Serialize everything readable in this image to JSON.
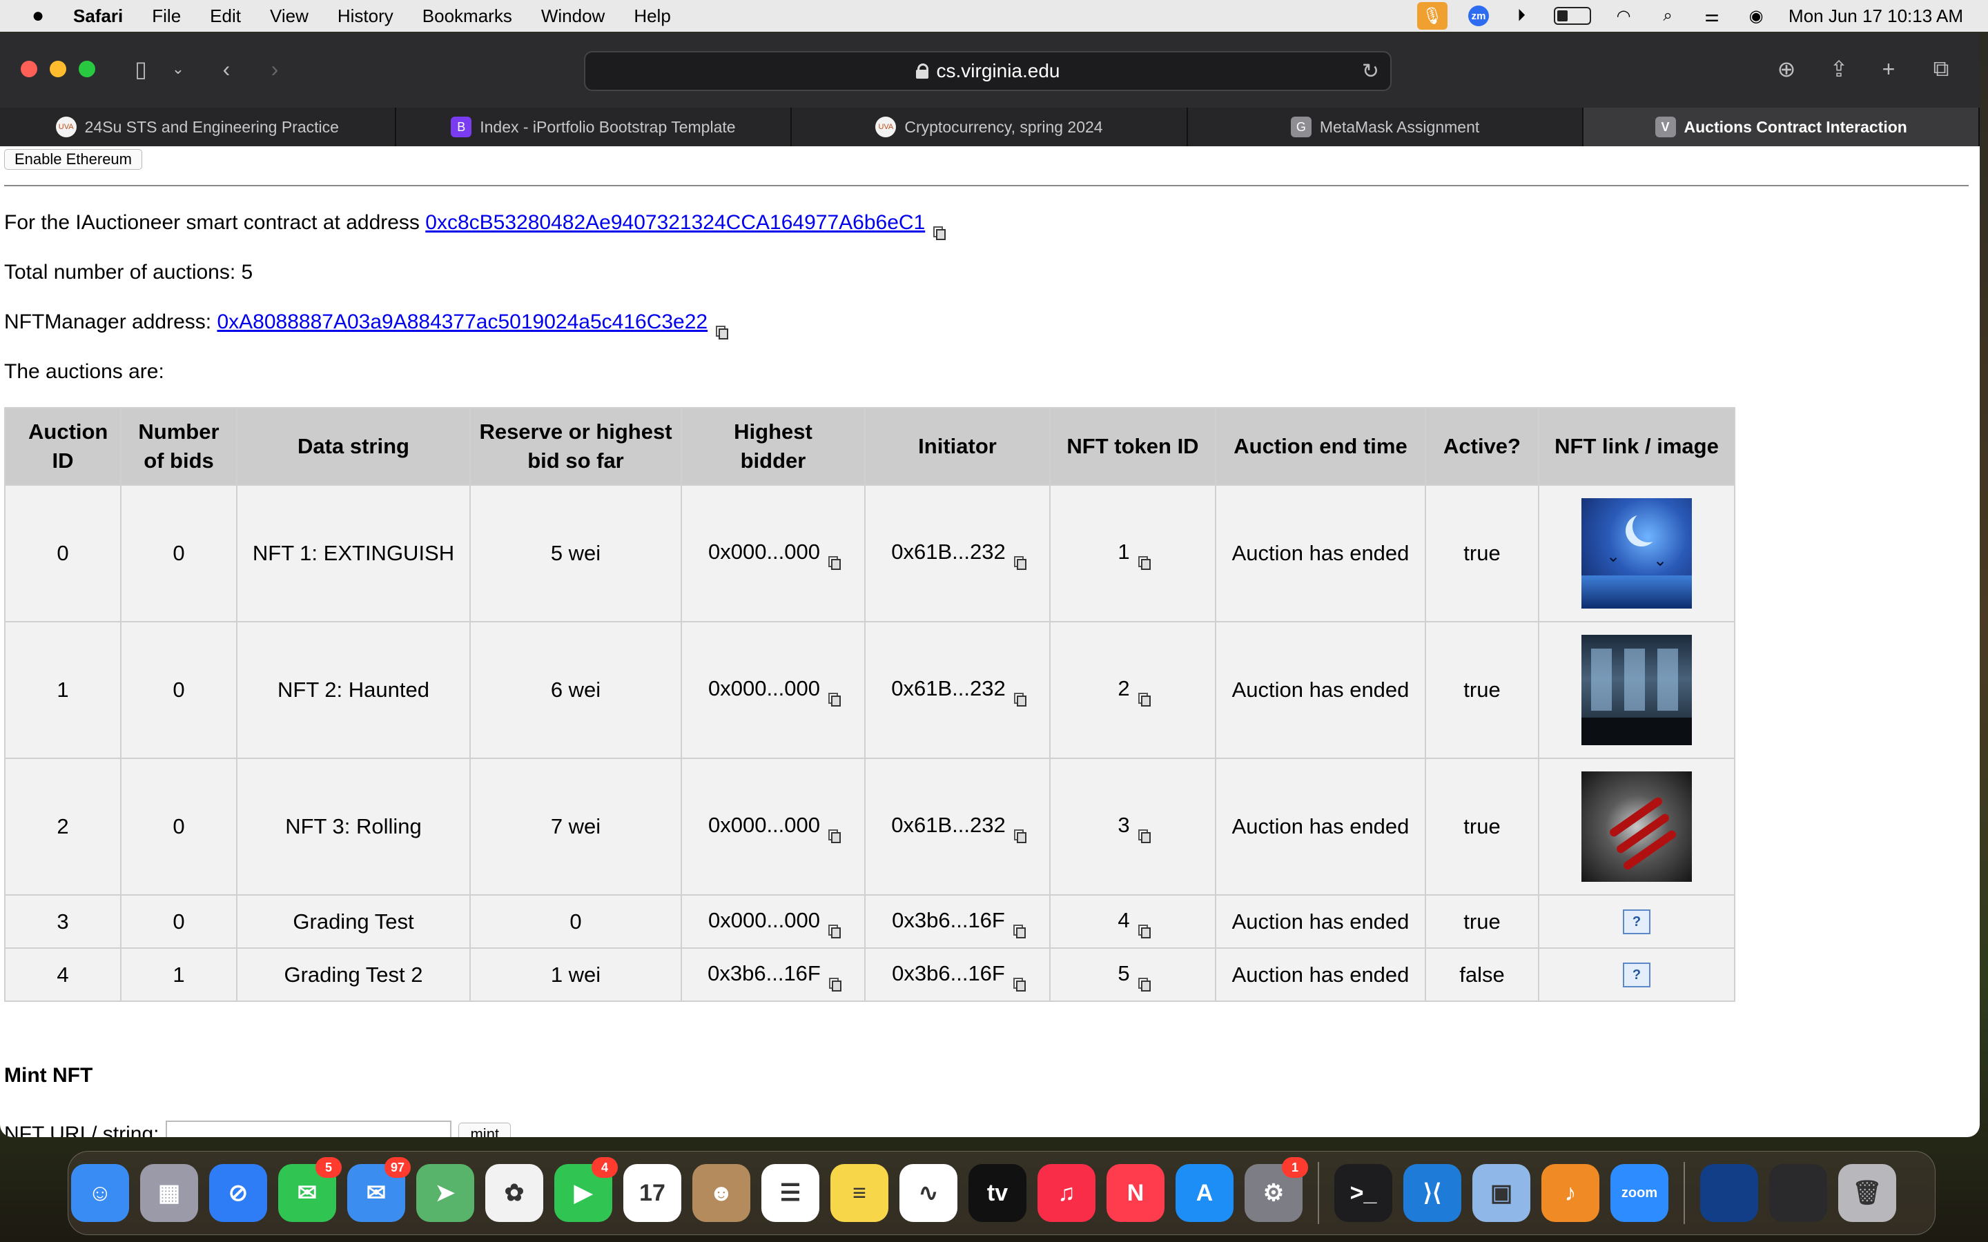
{
  "menubar": {
    "app_name": "Safari",
    "menus": [
      "File",
      "Edit",
      "View",
      "History",
      "Bookmarks",
      "Window",
      "Help"
    ],
    "clock": "Mon Jun 17  10:13 AM",
    "battery_level": 0.35
  },
  "browser": {
    "url": "cs.virginia.edu",
    "tabs": [
      {
        "label": "24Su STS and Engineering Practice",
        "icon": "uva-icon",
        "color": "#f3f3f3",
        "glyph": "UVA"
      },
      {
        "label": "Index - iPortfolio Bootstrap Template",
        "icon": "bootstrap-icon",
        "color": "#7a3cf0",
        "glyph": "B"
      },
      {
        "label": "Cryptocurrency, spring 2024",
        "icon": "uva-icon",
        "color": "#f3f3f3",
        "glyph": "UVA"
      },
      {
        "label": "MetaMask Assignment",
        "icon": "g-icon",
        "color": "#8d8d92",
        "glyph": "G"
      },
      {
        "label": "Auctions Contract Interaction",
        "icon": "v-icon",
        "color": "#8d8d92",
        "glyph": "V"
      }
    ]
  },
  "page": {
    "enable_button": "Enable Ethereum",
    "contract_prefix": "For the IAuctioneer smart contract at address ",
    "contract_address": "0xc8cB53280482Ae9407321324CCA164977A6b6eC1",
    "total_label": "Total number of auctions: 5",
    "nftmanager_prefix": "NFTManager address: ",
    "nftmanager_address": "0xA8088887A03a9A884377ac5019024a5c416C3e22",
    "auctions_label": "The auctions are:",
    "headers": {
      "auction_id": "Auction ID",
      "num_bids": "Number of bids",
      "data_string": "Data string",
      "reserve": "Reserve or highest bid so far",
      "highest_bidder": "Highest bidder",
      "initiator": "Initiator",
      "token_id": "NFT token ID",
      "end_time": "Auction end time",
      "active": "Active?",
      "link": "NFT link / image"
    },
    "rows": [
      {
        "id": "0",
        "bids": "0",
        "data": "NFT 1: EXTINGUISH",
        "reserve": "5 wei",
        "bidder": "0x000...000",
        "initiator": "0x61B...232",
        "token": "1",
        "end": "Auction has ended",
        "active": "true",
        "image": "night-moon-birds-image"
      },
      {
        "id": "1",
        "bids": "0",
        "data": "NFT 2: Haunted",
        "reserve": "6 wei",
        "bidder": "0x000...000",
        "initiator": "0x61B...232",
        "token": "2",
        "end": "Auction has ended",
        "active": "true",
        "image": "dark-building-interior-image"
      },
      {
        "id": "2",
        "bids": "0",
        "data": "NFT 3: Rolling",
        "reserve": "7 wei",
        "bidder": "0x000...000",
        "initiator": "0x61B...232",
        "token": "3",
        "end": "Auction has ended",
        "active": "true",
        "image": "red-claw-hand-image"
      },
      {
        "id": "3",
        "bids": "0",
        "data": "Grading Test",
        "reserve": "0",
        "bidder": "0x000...000",
        "initiator": "0x3b6...16F",
        "token": "4",
        "end": "Auction has ended",
        "active": "true",
        "image": "missing-image-icon"
      },
      {
        "id": "4",
        "bids": "1",
        "data": "Grading Test 2",
        "reserve": "1 wei",
        "bidder": "0x3b6...16F",
        "initiator": "0x3b6...16F",
        "token": "5",
        "end": "Auction has ended",
        "active": "false",
        "image": "missing-image-icon"
      }
    ],
    "mint_heading": "Mint NFT",
    "mint_label": "NFT URI / string: ",
    "mint_input_value": "",
    "mint_button": "mint"
  },
  "dock": {
    "apps": [
      {
        "name": "finder-icon",
        "color": "#3a8cf5",
        "glyph": "☺"
      },
      {
        "name": "launchpad-icon",
        "color": "#9a9aa8",
        "glyph": "▦"
      },
      {
        "name": "safari-icon",
        "color": "#2e7cf6",
        "glyph": "⊘"
      },
      {
        "name": "messages-icon",
        "color": "#30c452",
        "glyph": "✉",
        "badge": "5"
      },
      {
        "name": "mail-icon",
        "color": "#3b8df0",
        "glyph": "✉",
        "badge": "97"
      },
      {
        "name": "maps-icon",
        "color": "#58b46a",
        "glyph": "➤"
      },
      {
        "name": "photos-icon",
        "color": "#f2f2f2",
        "glyph": "✿"
      },
      {
        "name": "facetime-icon",
        "color": "#30c452",
        "glyph": "▶",
        "badge": "4"
      },
      {
        "name": "calendar-icon",
        "color": "#ffffff",
        "glyph": "17"
      },
      {
        "name": "contacts-icon",
        "color": "#b38b5d",
        "glyph": "☻"
      },
      {
        "name": "reminders-icon",
        "color": "#ffffff",
        "glyph": "☰"
      },
      {
        "name": "notes-icon",
        "color": "#f7d64a",
        "glyph": "≡"
      },
      {
        "name": "freeform-icon",
        "color": "#ffffff",
        "glyph": "∿"
      },
      {
        "name": "tv-icon",
        "color": "#111111",
        "glyph": "tv"
      },
      {
        "name": "music-icon",
        "color": "#fa2d48",
        "glyph": "♫"
      },
      {
        "name": "news-icon",
        "color": "#ff3b4e",
        "glyph": "N"
      },
      {
        "name": "app-store-icon",
        "color": "#1c8ef5",
        "glyph": "A"
      },
      {
        "name": "system-settings-icon",
        "color": "#7d7d85",
        "glyph": "⚙",
        "badge": "1"
      },
      {
        "name": "terminal-icon",
        "color": "#1d1d1f",
        "glyph": ">_"
      },
      {
        "name": "vscode-icon",
        "color": "#1f7bd8",
        "glyph": "⟩⟨"
      },
      {
        "name": "preview-icon",
        "color": "#8fb8e8",
        "glyph": "▣"
      },
      {
        "name": "garageband-icon",
        "color": "#f08a24",
        "glyph": "♪"
      },
      {
        "name": "zoom-icon",
        "color": "#2d8cff",
        "glyph": "zoom"
      },
      {
        "name": "recent-image-icon",
        "color": "#123e88",
        "glyph": ""
      },
      {
        "name": "recent-window-icon",
        "color": "#2a2a2c",
        "glyph": ""
      },
      {
        "name": "trash-icon",
        "color": "#b8b8bc",
        "glyph": "🗑"
      }
    ]
  }
}
